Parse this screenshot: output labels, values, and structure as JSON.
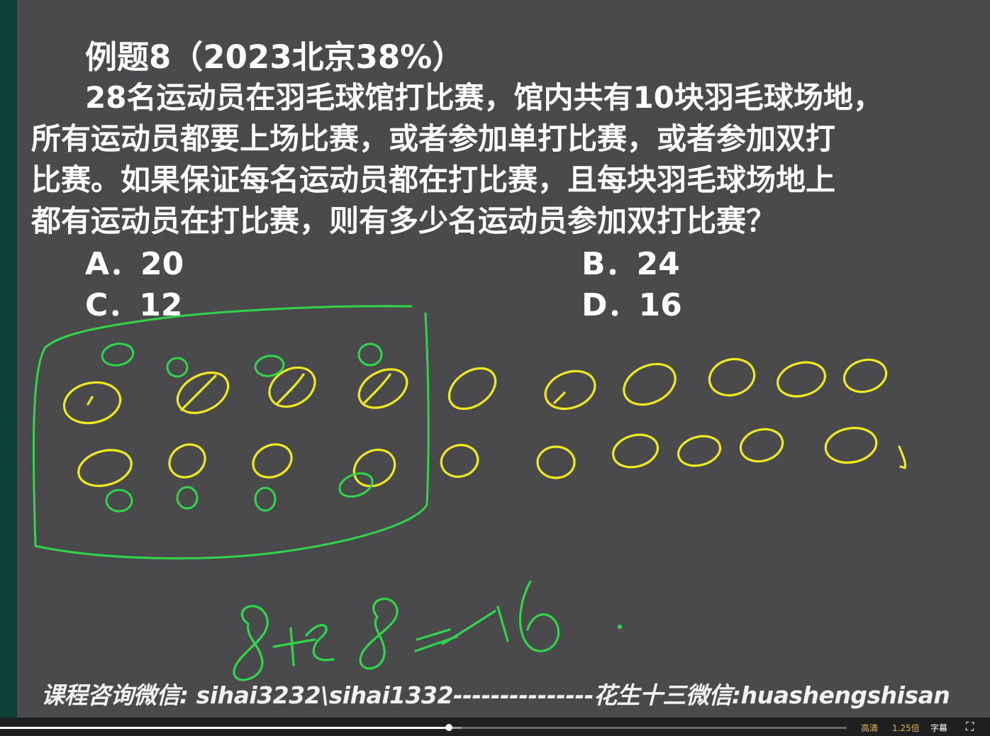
{
  "slide": {
    "title": "例题8（2023北京38%）",
    "question_lines": [
      "28名运动员在羽毛球馆打比赛，馆内共有10块羽毛球场地，",
      "所有运动员都要上场比赛，或者参加单打比赛，或者参加双打",
      "比赛。如果保证每名运动员都在打比赛，且每块羽毛球场地上",
      "都有运动员在打比赛，则有多少名运动员参加双打比赛？"
    ],
    "options": {
      "a": "A．20",
      "b": "B．24",
      "c": "C．12",
      "d": "D．16"
    },
    "footer": "课程咨询微信: sihai3232\\sihai1332---------------花生十三微信:huashengshisan"
  },
  "player": {
    "progress": 0.53,
    "buffered": 0.545,
    "quality": "高清",
    "speed": "1.25倍",
    "subtitle": "字幕",
    "fullscreen_icon": "fullscreen-icon"
  },
  "colors": {
    "background": "#4a4a4c",
    "left_bar": "#0c4038",
    "text": "#ffffff",
    "ink_yellow": "#f0ea1a",
    "ink_green": "#2fd64a"
  }
}
